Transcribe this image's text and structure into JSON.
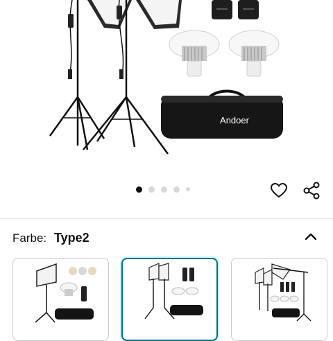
{
  "product": {
    "brand_on_bag": "Andoer"
  },
  "carousel": {
    "slide_count": 5,
    "active_index": 0
  },
  "actions": {
    "favorite_icon": "heart-icon",
    "share_icon": "share-icon"
  },
  "variant_selector": {
    "label": "Farbe:",
    "selected_value": "Type2",
    "toggle_icon": "chevron-up-icon",
    "options": [
      {
        "id": "type1",
        "selected": false
      },
      {
        "id": "type2",
        "selected": true
      },
      {
        "id": "type3",
        "selected": false
      }
    ]
  },
  "colors": {
    "selected_border": "#007185",
    "divider": "#e3e6e6",
    "text": "#0f1111"
  }
}
